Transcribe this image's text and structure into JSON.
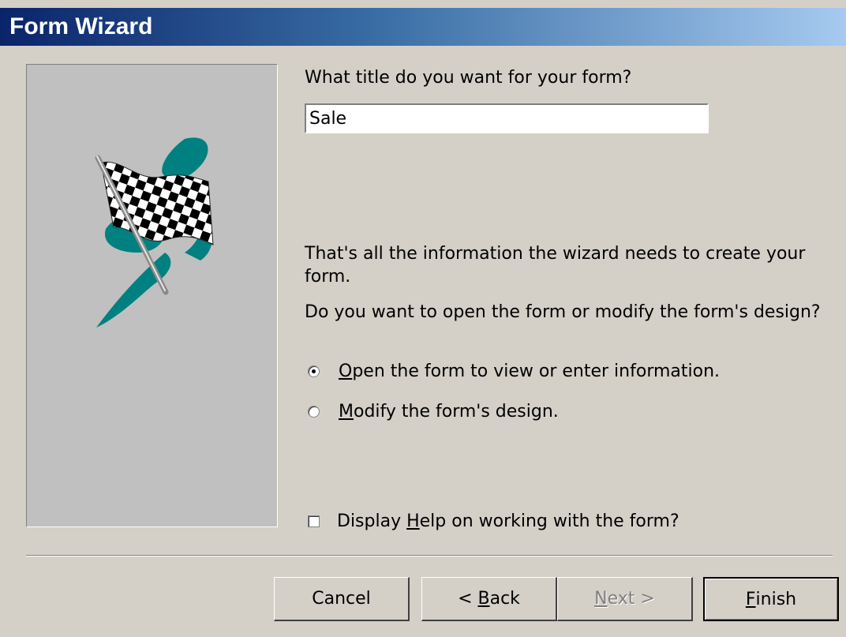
{
  "window": {
    "title": "Form Wizard"
  },
  "prompt": {
    "title_question": "What title do you want for your form?"
  },
  "title_input": {
    "value": "Sale"
  },
  "info": {
    "line1": "That's all the information the wizard needs to create your",
    "line2": "form.",
    "question": "Do you want to open the form or modify the form's design?"
  },
  "options": [
    {
      "label_pre": "",
      "label_u": "O",
      "label_post": "pen the form to view or enter information.",
      "checked": true
    },
    {
      "label_pre": "",
      "label_u": "M",
      "label_post": "odify the form's design.",
      "checked": false
    }
  ],
  "help_checkbox": {
    "label_pre": "Display ",
    "label_u": "H",
    "label_post": "elp on working with the form?",
    "checked": false
  },
  "buttons": {
    "cancel": {
      "pre": "Cancel",
      "u": "",
      "post": ""
    },
    "back": {
      "pre": "< ",
      "u": "B",
      "post": "ack"
    },
    "next": {
      "pre": "",
      "u": "N",
      "post": "ext >"
    },
    "finish": {
      "pre": "",
      "u": "F",
      "post": "inish"
    }
  },
  "colors": {
    "accent_teal": "#008080",
    "title_bar_start": "#0a246a",
    "title_bar_end": "#a6caf0"
  },
  "icons": {
    "wizard_image": "checkered-flag-icon"
  }
}
